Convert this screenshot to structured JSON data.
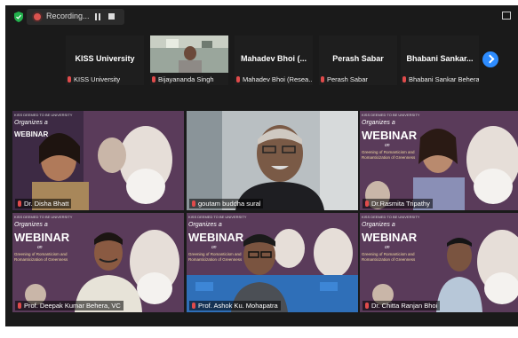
{
  "recording": {
    "label": "Recording..."
  },
  "thumbnails": [
    {
      "name": "KISS University",
      "label": "KISS University",
      "has_video": false
    },
    {
      "name": "",
      "label": "Bijayananda Singh",
      "has_video": true
    },
    {
      "name": "Mahadev  Bhoi (...",
      "label": "Mahadev Bhoi (Resea...",
      "has_video": false
    },
    {
      "name": "Perash Sabar",
      "label": "Perash Sabar",
      "has_video": false
    },
    {
      "name": "Bhabani  Sankar...",
      "label": "Bhabani Sankar Behera",
      "has_video": false
    }
  ],
  "tiles": [
    {
      "label": "Dr. Disha Bhatt",
      "kind": "webinar"
    },
    {
      "label": "goutam buddha sural",
      "kind": "person"
    },
    {
      "label": "Dr.Rasmita Tripathy",
      "kind": "webinar"
    },
    {
      "label": "Prof. Deepak Kumar Behera, VC",
      "kind": "webinar",
      "active": true
    },
    {
      "label": "Prof. Ashok Ku. Mohapatra",
      "kind": "webinar"
    },
    {
      "label": "Dr. Chitta Ranjan Bhoi",
      "kind": "webinar"
    }
  ],
  "webinar": {
    "word": "WEBINAR",
    "organizes": "Organizes a",
    "on": "on",
    "topic_line1": "Greening of Romanticism and",
    "topic_line2": "Romanticization of Greenness"
  },
  "colors": {
    "accent": "#2d8cff",
    "active_border": "#c6e06a",
    "muted_mic": "#e04b4b"
  }
}
